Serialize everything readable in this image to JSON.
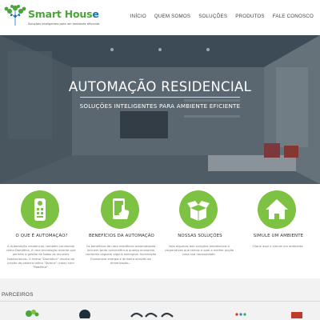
{
  "header": {
    "logo": {
      "title_left": "Smart Hous",
      "title_right": "e",
      "tagline": "Soluções inteligentes para um ambiente eficiente",
      "icon": "tree-network-logo"
    },
    "nav": [
      {
        "label": "INÍCIO"
      },
      {
        "label": "QUEM SOMOS"
      },
      {
        "label": "SOLUÇÕES"
      },
      {
        "label": "PRODUTOS"
      },
      {
        "label": "FALE CONOSCO"
      }
    ]
  },
  "hero": {
    "title": "AUTOMAÇÃO RESIDENCIAL",
    "subtitle": "SOLUÇÕES INTELIGENTES PARA AMBIENTE EFICIENTE"
  },
  "features": [
    {
      "icon": "remote-control-icon",
      "title": "O QUE É AUTOMAÇÃO?",
      "text": "A Automação residencial, também conhecida como Domótica, é uma tecnologia recente que permite a gestão de todos os recursos habitacionais. O termo \"Domótica\" resulta da junção da palavra latina \"Domus\" (casa) com \"Robótica\"."
    },
    {
      "icon": "phone-touch-icon",
      "title": "BENEFÍCIOS DA AUTOMAÇÃO",
      "text": "Os benefícios de uma residência automatizada incluem tanto conveniência quanto economia conforme seguem alguns exemplos: Iluminação Economize energia e dinheiro através da dimerização..."
    },
    {
      "icon": "open-box-icon",
      "title": "NOSSAS SOLUÇÕES",
      "text": "Veja algumas das soluções residenciais e corporativas que temos e qual a melhor opção para sua necessidade."
    },
    {
      "icon": "house-icon",
      "title": "SIMULE UM AMBIENTE",
      "text": "Clique aqui e simule um ambiente"
    }
  ],
  "partners": {
    "title": "PARCEIROS"
  },
  "colors": {
    "accent_green": "#7dc242",
    "logo_green": "#4aa63a",
    "logo_blue": "#1f6fa8"
  }
}
